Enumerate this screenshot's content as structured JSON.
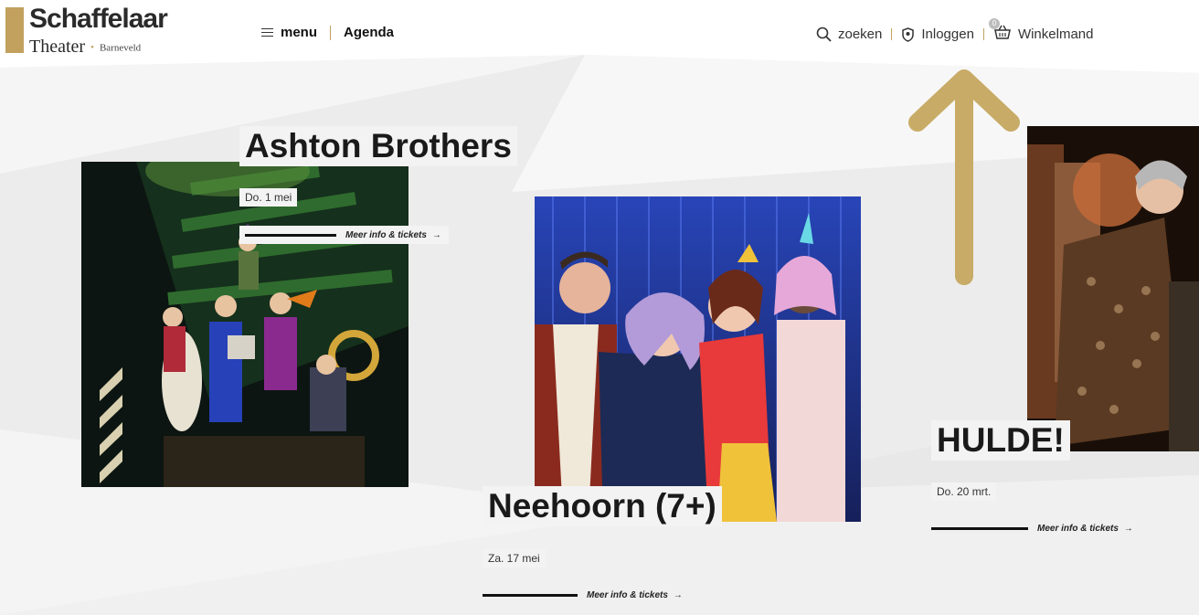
{
  "logo": {
    "name": "Schaffelaar",
    "sub": "Theater",
    "city": "Barneveld"
  },
  "nav": {
    "menu": "menu",
    "agenda": "Agenda",
    "search": "zoeken",
    "login": "Inloggen",
    "cart": "Winkelmand",
    "cart_count": "0"
  },
  "icons": {
    "menu": "hamburger-icon",
    "search": "search-icon",
    "login": "user-shield-icon",
    "cart": "basket-icon",
    "annotation": "up-arrow-icon",
    "tickets": "right-arrow-icon"
  },
  "colors": {
    "accent": "#c2a15f",
    "arrow": "#c8ab66"
  },
  "events": [
    {
      "title": "Ashton Brothers",
      "date": "Do. 1 mei",
      "cta": "Meer info & tickets",
      "arrow": "→"
    },
    {
      "title": "Neehoorn (7+)",
      "date": "Za. 17 mei",
      "cta": "Meer info & tickets",
      "arrow": "→"
    },
    {
      "title": "HULDE!",
      "date": "Do. 20 mrt.",
      "cta": "Meer info & tickets",
      "arrow": "→"
    }
  ]
}
